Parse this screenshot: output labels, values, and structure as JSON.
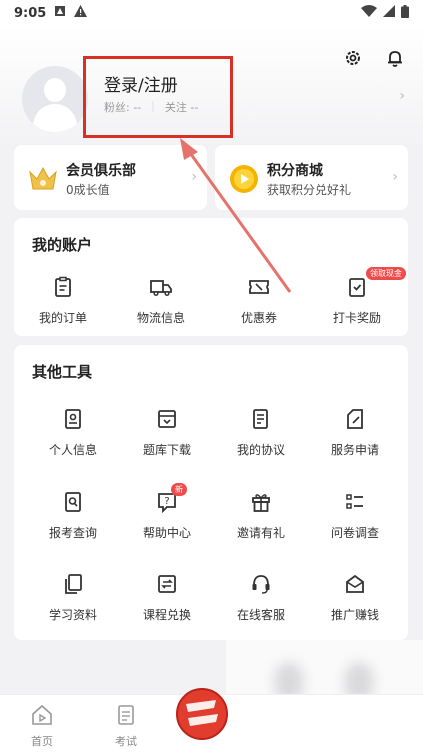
{
  "status_bar": {
    "time": "9:05"
  },
  "profile": {
    "login_label": "登录/注册",
    "fans_label": "粉丝: --",
    "follow_label": "关注 --"
  },
  "member_club": {
    "title": "会员俱乐部",
    "subtitle": "0成长值"
  },
  "points_mall": {
    "title": "积分商城",
    "subtitle": "获取积分兑好礼"
  },
  "account": {
    "title": "我的账户",
    "items": [
      {
        "label": "我的订单",
        "icon": "clipboard-icon"
      },
      {
        "label": "物流信息",
        "icon": "truck-icon"
      },
      {
        "label": "优惠券",
        "icon": "ticket-icon"
      },
      {
        "label": "打卡奖励",
        "icon": "checkin-icon",
        "badge": "领取现金"
      }
    ]
  },
  "tools": {
    "title": "其他工具",
    "items": [
      {
        "label": "个人信息",
        "icon": "profile-card-icon"
      },
      {
        "label": "题库下载",
        "icon": "download-icon"
      },
      {
        "label": "我的协议",
        "icon": "document-icon"
      },
      {
        "label": "服务申请",
        "icon": "edit-icon"
      },
      {
        "label": "报考查询",
        "icon": "search-doc-icon"
      },
      {
        "label": "帮助中心",
        "icon": "help-icon",
        "badge": "新"
      },
      {
        "label": "邀请有礼",
        "icon": "gift-icon"
      },
      {
        "label": "问卷调查",
        "icon": "list-icon"
      },
      {
        "label": "学习资料",
        "icon": "files-icon"
      },
      {
        "label": "课程兑换",
        "icon": "exchange-icon"
      },
      {
        "label": "在线客服",
        "icon": "headset-icon"
      },
      {
        "label": "推广赚钱",
        "icon": "mail-money-icon"
      }
    ]
  },
  "bottom_nav": [
    {
      "label": "首页",
      "icon": "home-icon"
    },
    {
      "label": "考试",
      "icon": "exam-icon"
    }
  ],
  "colors": {
    "accent_red": "#d93025",
    "badge_red": "#ef4b4b",
    "gold": "#f5b400"
  }
}
